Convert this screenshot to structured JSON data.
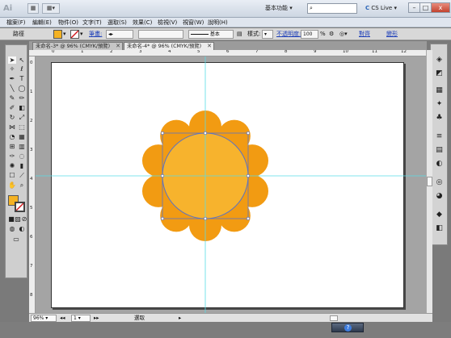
{
  "app": {
    "logo": "Ai",
    "workspace": "基本功能",
    "cs_live": "CS Live"
  },
  "window_controls": [
    "–",
    "□",
    "x"
  ],
  "menu": [
    "檔案(F)",
    "編輯(E)",
    "物件(O)",
    "文字(T)",
    "選取(S)",
    "效果(C)",
    "檢視(V)",
    "視窗(W)",
    "說明(H)"
  ],
  "control": {
    "selection_label": "路徑",
    "stroke_label": "筆畫:",
    "brush_label": "基本",
    "style_label": "樣式:",
    "opacity_label": "不透明度:",
    "opacity_value": "100",
    "opacity_unit": "%",
    "align_label": "對齊",
    "transform_label": "變形",
    "fill_color": "#f4b223"
  },
  "tabs": [
    {
      "label": "未命名-3* @ 96% (CMYK/預覽)",
      "close": "✕"
    },
    {
      "label": "未命名-4* @ 96% (CMYK/預覽)",
      "close": "✕"
    }
  ],
  "ruler_top": [
    "0",
    "1",
    "2",
    "3",
    "4",
    "5",
    "6",
    "7",
    "8",
    "9",
    "10",
    "11",
    "12"
  ],
  "ruler_left": [
    "0",
    "1",
    "2",
    "3",
    "4",
    "5",
    "6",
    "7",
    "8"
  ],
  "status": {
    "zoom": "96%",
    "page": "1",
    "mode": "選取"
  },
  "art": {
    "flower_color": "#f29b12",
    "center_color": "#f7b32d",
    "guide_color": "#59dce6",
    "path_color": "#5a73c4"
  }
}
